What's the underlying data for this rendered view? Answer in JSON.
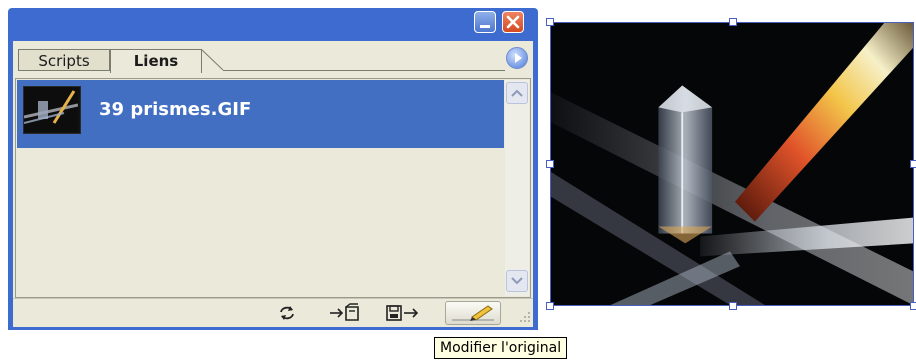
{
  "panel": {
    "tabs": [
      {
        "label": "Scripts",
        "active": false
      },
      {
        "label": "Liens",
        "active": true
      }
    ],
    "items": [
      {
        "name": "39 prismes.GIF",
        "selected": true,
        "icon": "prism-thumbnail"
      }
    ],
    "footer_buttons": [
      {
        "icon": "relink-icon"
      },
      {
        "icon": "go-to-link-icon"
      },
      {
        "icon": "update-link-icon"
      },
      {
        "icon": "edit-original-icon",
        "pressed": true
      }
    ]
  },
  "tooltip": {
    "text": "Modifier l'original"
  },
  "colors": {
    "panel_frame": "#3d6bcf",
    "panel_body": "#ebe9d9",
    "selection": "#436fc2",
    "close_button": "#d24a22",
    "tooltip_bg": "#ffffe1"
  }
}
